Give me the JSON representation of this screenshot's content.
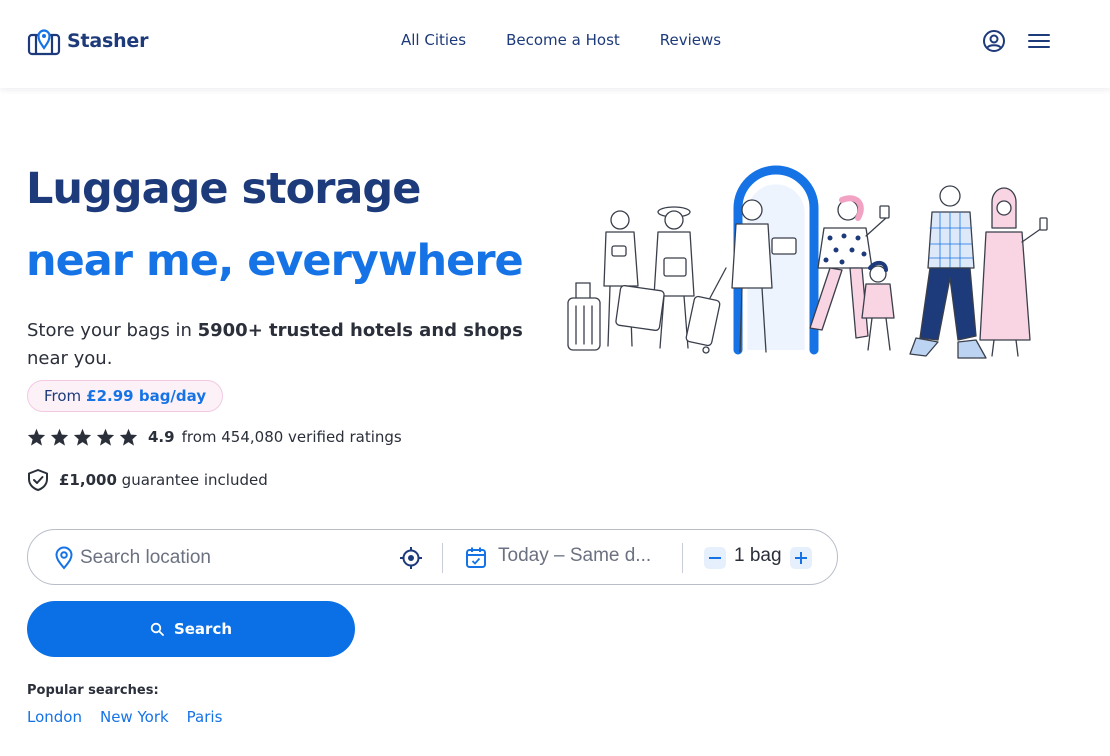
{
  "brand": {
    "name": "Stasher",
    "logo_icon": "map-pin-suitcase-icon"
  },
  "nav": {
    "items": [
      "All Cities",
      "Become a Host",
      "Reviews"
    ]
  },
  "header_icons": {
    "account": "user-circle-icon",
    "menu": "hamburger-menu-icon"
  },
  "hero": {
    "title": "Luggage storage",
    "subtitle": "near me, everywhere",
    "description_prefix": "Store your bags in ",
    "description_bold": "5900+ trusted hotels and shops",
    "description_suffix": " near you."
  },
  "price": {
    "prefix": "From",
    "value": "£2.99 bag/day"
  },
  "rating": {
    "stars": 5,
    "score": "4.9",
    "text": "from 454,080 verified ratings"
  },
  "guarantee": {
    "amount": "£1,000",
    "text": "guarantee included"
  },
  "search": {
    "location_placeholder": "Search location",
    "date_text": "Today – Same d...",
    "bags_text": "1 bag",
    "button_label": "Search"
  },
  "popular": {
    "label": "Popular searches:",
    "links": [
      "London",
      "New York",
      "Paris"
    ]
  },
  "colors": {
    "navy": "#1d3a7a",
    "brand_blue": "#1673e6",
    "button_blue": "#0b6fe6",
    "pill_pink": "#fdf1f8"
  }
}
